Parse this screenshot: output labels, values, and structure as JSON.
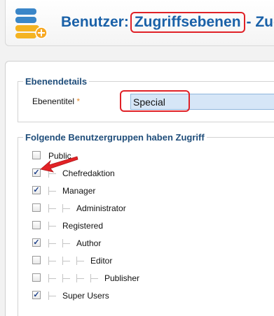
{
  "header": {
    "title_prefix": "Benutzer:",
    "title_highlight": "Zugriffsebenen",
    "title_suffix": "- Zug",
    "icon": "users-icon"
  },
  "details": {
    "legend": "Ebenendetails",
    "field_label": "Ebenentitel",
    "required_mark": "*",
    "title_value": "Special"
  },
  "groups": {
    "legend": "Folgende Benutzergruppen haben Zugriff",
    "items": [
      {
        "label": "Public",
        "checked": false,
        "depth": 0
      },
      {
        "label": "Chefredaktion",
        "checked": true,
        "depth": 1
      },
      {
        "label": "Manager",
        "checked": true,
        "depth": 1
      },
      {
        "label": "Administrator",
        "checked": false,
        "depth": 2
      },
      {
        "label": "Registered",
        "checked": false,
        "depth": 1
      },
      {
        "label": "Author",
        "checked": true,
        "depth": 2
      },
      {
        "label": "Editor",
        "checked": false,
        "depth": 3
      },
      {
        "label": "Publisher",
        "checked": false,
        "depth": 4
      },
      {
        "label": "Super Users",
        "checked": true,
        "depth": 1
      }
    ]
  },
  "colors": {
    "title_blue": "#1a61a8",
    "highlight_red": "#e02127",
    "legend_blue": "#1f4d7a"
  }
}
